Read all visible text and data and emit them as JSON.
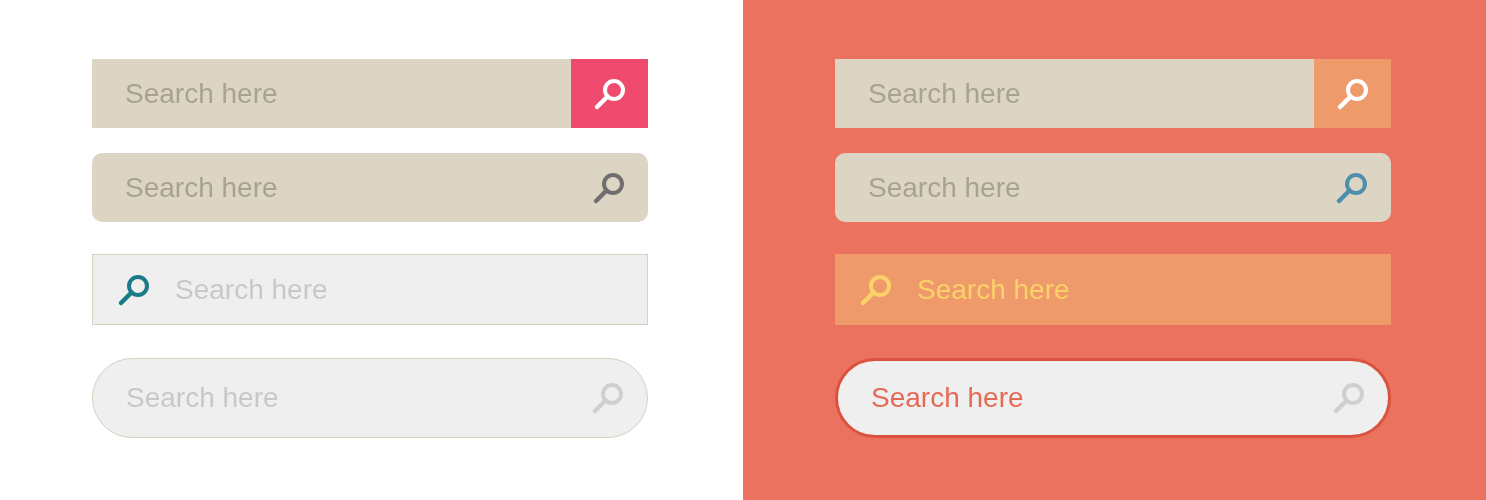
{
  "panels": [
    {
      "kind": "light",
      "bars": [
        {
          "kind": "button",
          "placeholder": "Search here"
        },
        {
          "kind": "rounded",
          "placeholder": "Search here"
        },
        {
          "kind": "outlined",
          "placeholder": "Search here"
        },
        {
          "kind": "pill",
          "placeholder": "Search here"
        }
      ]
    },
    {
      "kind": "coral",
      "bars": [
        {
          "kind": "button",
          "placeholder": "Search here"
        },
        {
          "kind": "rounded",
          "placeholder": "Search here"
        },
        {
          "kind": "outlined",
          "placeholder": "Search here"
        },
        {
          "kind": "pill",
          "placeholder": "Search here"
        }
      ]
    }
  ]
}
